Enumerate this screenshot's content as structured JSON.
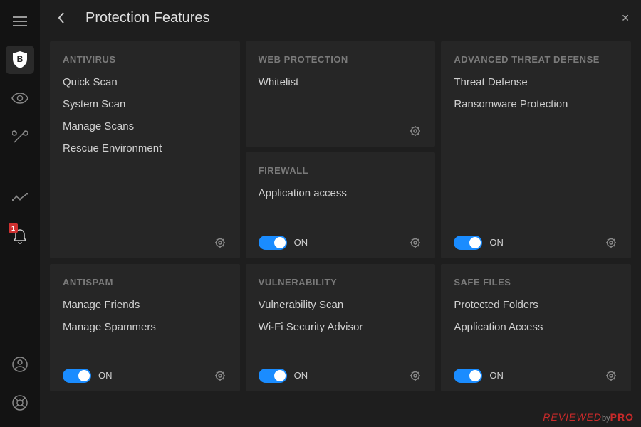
{
  "header": {
    "title": "Protection Features"
  },
  "sidebar": {
    "notification_badge": "1"
  },
  "cards": {
    "antivirus": {
      "title": "ANTIVIRUS",
      "items": [
        "Quick Scan",
        "System Scan",
        "Manage Scans",
        "Rescue Environment"
      ]
    },
    "web": {
      "title": "WEB PROTECTION",
      "items": [
        "Whitelist"
      ]
    },
    "threat": {
      "title": "ADVANCED THREAT DEFENSE",
      "items": [
        "Threat Defense",
        "Ransomware Protection"
      ],
      "toggle": "ON"
    },
    "firewall": {
      "title": "FIREWALL",
      "items": [
        "Application access"
      ],
      "toggle": "ON"
    },
    "antispam": {
      "title": "ANTISPAM",
      "items": [
        "Manage Friends",
        "Manage Spammers"
      ],
      "toggle": "ON"
    },
    "vuln": {
      "title": "VULNERABILITY",
      "items": [
        "Vulnerability Scan",
        "Wi-Fi Security Advisor"
      ],
      "toggle": "ON"
    },
    "safe": {
      "title": "SAFE FILES",
      "items": [
        "Protected Folders",
        "Application Access"
      ],
      "toggle": "ON"
    }
  },
  "watermark": {
    "a": "REVIEWED",
    "b": "by",
    "c": "PRO"
  }
}
